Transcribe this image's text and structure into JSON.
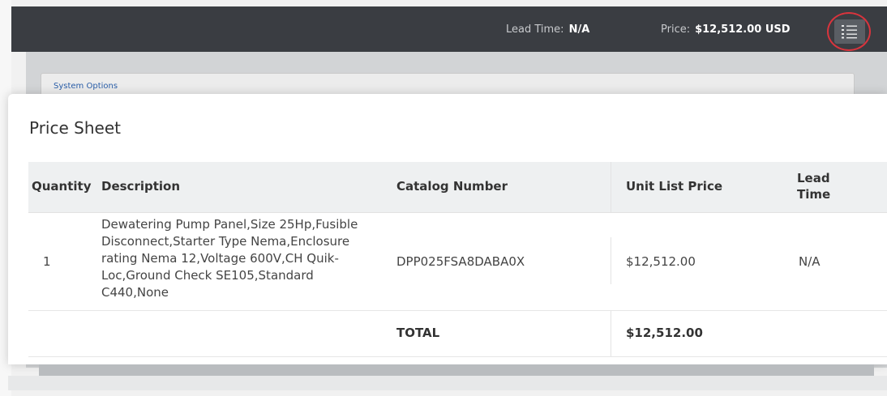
{
  "header": {
    "lead_time_label": "Lead Time:",
    "lead_time_value": "N/A",
    "price_label": "Price:",
    "price_value": "$12,512.00 USD"
  },
  "background": {
    "section_label": "System Options"
  },
  "modal": {
    "title": "Price Sheet",
    "columns": [
      "Quantity",
      "Description",
      "Catalog Number",
      "Unit List Price",
      "Lead Time"
    ],
    "rows": [
      {
        "quantity": "1",
        "description_lines": [
          "Dewatering Pump Panel,Size 25Hp,Fusible",
          "Disconnect,Starter Type Nema,Enclosure",
          "rating Nema 12,Voltage 600V,CH Quik-",
          "Loc,Ground Check SE105,Standard",
          "C440,None"
        ],
        "catalog_number": "DPP025FSA8DABA0X",
        "unit_list_price": "$12,512.00",
        "lead_time": "N/A"
      }
    ],
    "total_label": "TOTAL",
    "total_value": "$12,512.00"
  },
  "icons": {
    "menu_button": "list-icon"
  },
  "colors": {
    "topbar": "#3a3d42",
    "highlight_ring": "#d9343d",
    "link": "#2a5ea8"
  }
}
